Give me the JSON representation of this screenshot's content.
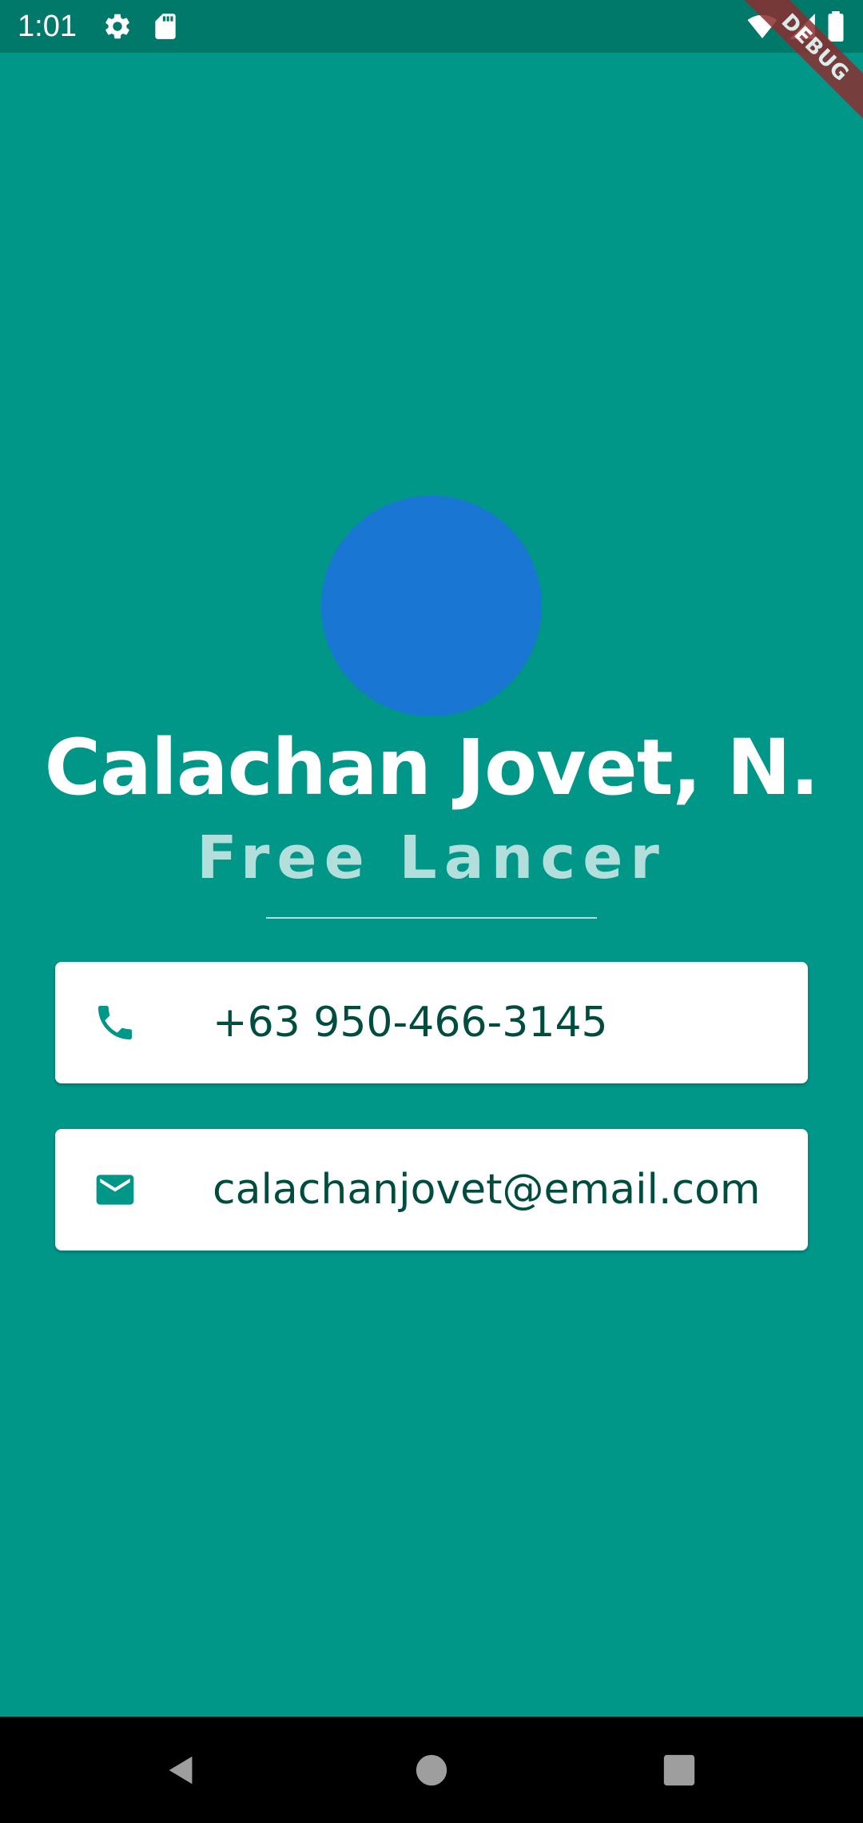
{
  "status_bar": {
    "time": "1:01",
    "icons": [
      "gear-icon",
      "sd-card-icon",
      "wifi-icon",
      "signal-icon",
      "battery-icon"
    ]
  },
  "debug_banner": {
    "label": "DEBUG"
  },
  "profile": {
    "name": "Calachan Jovet, N.",
    "title": "Free Lancer"
  },
  "contacts": {
    "phone": {
      "icon": "phone-icon",
      "value": "+63 950-466-3145"
    },
    "email": {
      "icon": "mail-icon",
      "value": "calachanjovet@email.com"
    }
  },
  "navigation": {
    "buttons": [
      "back-icon",
      "home-icon",
      "recents-icon"
    ]
  },
  "colors": {
    "background": "#009688",
    "status_bar": "#00796b",
    "avatar": "#1976d2",
    "title": "#b2dfdb",
    "card_text": "#004d40",
    "icon": "#009688"
  }
}
